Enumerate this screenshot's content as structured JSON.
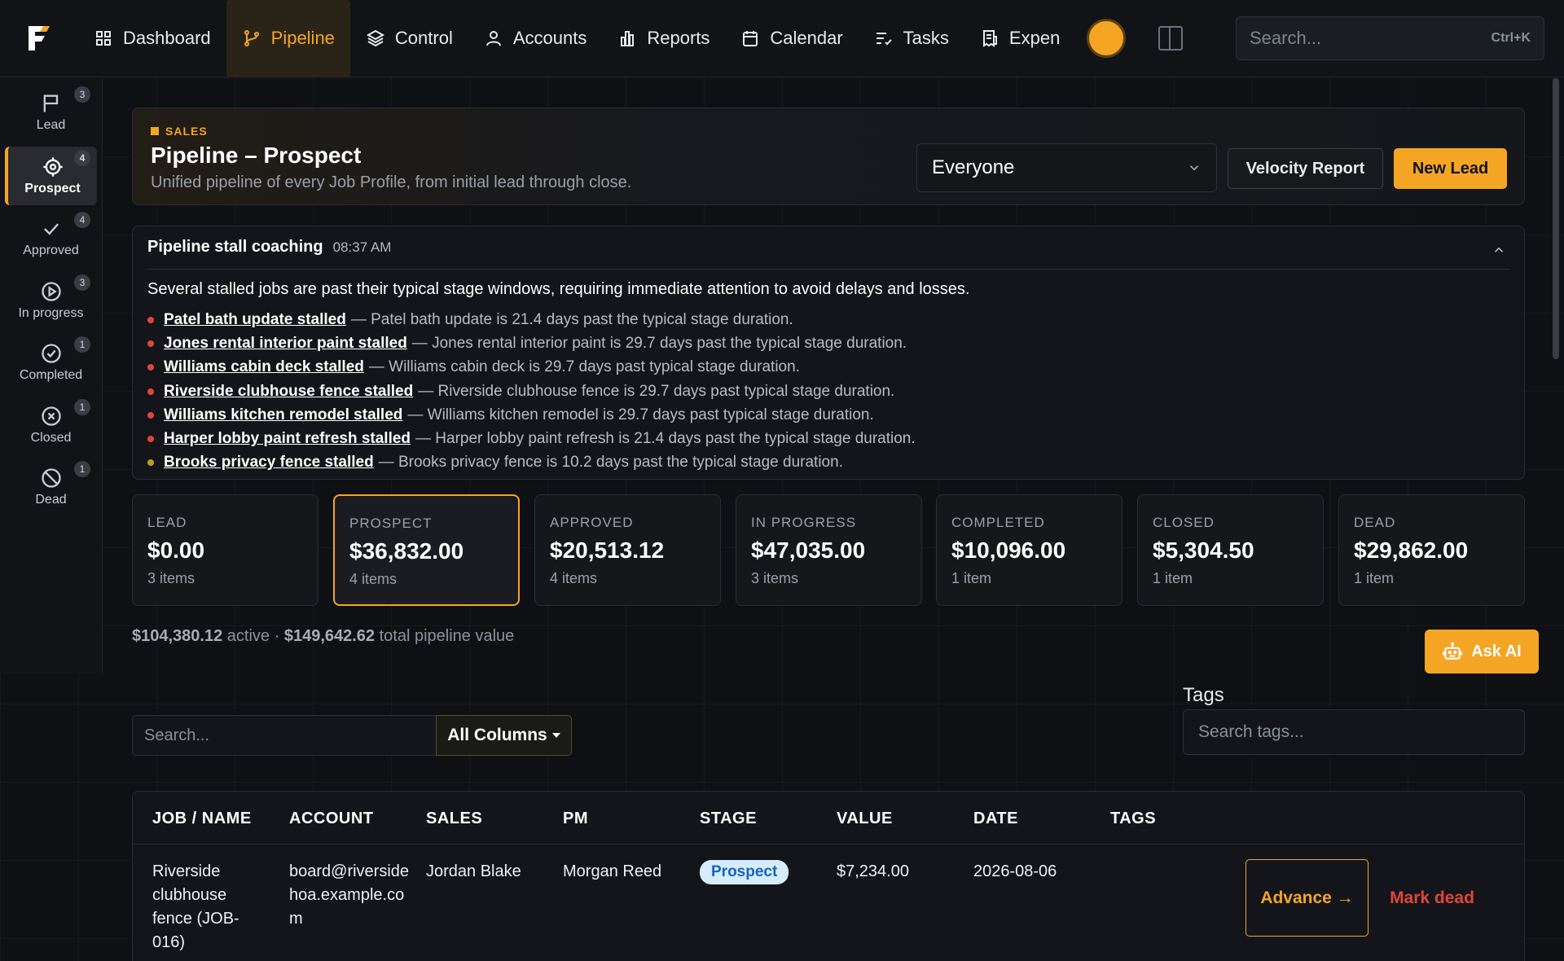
{
  "brand": {
    "logo_letter": "F"
  },
  "nav": {
    "items": [
      {
        "label": "Dashboard",
        "icon": "grid-icon"
      },
      {
        "label": "Pipeline",
        "icon": "branch-icon",
        "active": true
      },
      {
        "label": "Control",
        "icon": "layers-icon"
      },
      {
        "label": "Accounts",
        "icon": "user-icon"
      },
      {
        "label": "Reports",
        "icon": "bar-chart-icon"
      },
      {
        "label": "Calendar",
        "icon": "calendar-icon"
      },
      {
        "label": "Tasks",
        "icon": "list-check-icon"
      },
      {
        "label": "Expen",
        "icon": "receipt-icon"
      }
    ],
    "search_placeholder": "Search...",
    "search_shortcut": "Ctrl+K"
  },
  "sidebar": {
    "items": [
      {
        "label": "Lead",
        "count": "3",
        "icon": "flag-icon"
      },
      {
        "label": "Prospect",
        "count": "4",
        "icon": "target-icon",
        "active": true
      },
      {
        "label": "Approved",
        "count": "4",
        "icon": "check-icon"
      },
      {
        "label": "In progress",
        "count": "3",
        "icon": "play-circle-icon"
      },
      {
        "label": "Completed",
        "count": "1",
        "icon": "check-circle-icon"
      },
      {
        "label": "Closed",
        "count": "1",
        "icon": "x-circle-icon"
      },
      {
        "label": "Dead",
        "count": "1",
        "icon": "ban-icon"
      }
    ]
  },
  "header": {
    "eyebrow": "SALES",
    "title": "Pipeline – Prospect",
    "subtitle": "Unified pipeline of every Job Profile, from initial lead through close.",
    "owner_filter": "Everyone",
    "velocity_button": "Velocity Report",
    "new_lead_button": "New Lead"
  },
  "coaching": {
    "title": "Pipeline stall coaching",
    "time": "08:37 AM",
    "summary": "Several stalled jobs are past their typical stage windows, requiring immediate attention to avoid delays and losses.",
    "items": [
      {
        "link": "Patel bath update stalled",
        "text": "— Patel bath update is 21.4 days past the typical stage duration.",
        "severity_color": "#e0453a"
      },
      {
        "link": "Jones rental interior paint stalled",
        "text": "— Jones rental interior paint is 29.7 days past the typical stage duration.",
        "severity_color": "#e0453a"
      },
      {
        "link": "Williams cabin deck stalled",
        "text": "— Williams cabin deck is 29.7 days past typical stage duration.",
        "severity_color": "#e0453a"
      },
      {
        "link": "Riverside clubhouse fence stalled",
        "text": "— Riverside clubhouse fence is 29.7 days past typical stage duration.",
        "severity_color": "#e0453a"
      },
      {
        "link": "Williams kitchen remodel stalled",
        "text": "— Williams kitchen remodel is 29.7 days past typical stage duration.",
        "severity_color": "#e0453a"
      },
      {
        "link": "Harper lobby paint refresh stalled",
        "text": "— Harper lobby paint refresh is 21.4 days past the typical stage duration.",
        "severity_color": "#e0453a"
      },
      {
        "link": "Brooks privacy fence stalled",
        "text": "— Brooks privacy fence is 10.2 days past the typical stage duration.",
        "severity_color": "#b8a21c"
      }
    ]
  },
  "stages": [
    {
      "name": "LEAD",
      "value": "$0.00",
      "count": "3 items"
    },
    {
      "name": "PROSPECT",
      "value": "$36,832.00",
      "count": "4 items",
      "active": true
    },
    {
      "name": "APPROVED",
      "value": "$20,513.12",
      "count": "4 items"
    },
    {
      "name": "IN PROGRESS",
      "value": "$47,035.00",
      "count": "3 items"
    },
    {
      "name": "COMPLETED",
      "value": "$10,096.00",
      "count": "1 item"
    },
    {
      "name": "CLOSED",
      "value": "$5,304.50",
      "count": "1 item"
    },
    {
      "name": "DEAD",
      "value": "$29,862.00",
      "count": "1 item"
    }
  ],
  "totals": {
    "active_value": "$104,380.12",
    "active_label": "active ·",
    "total_value": "$149,642.62",
    "total_label": "total pipeline value"
  },
  "ask_ai": "Ask AI",
  "filters": {
    "search_placeholder": "Search...",
    "column_select": "All Columns",
    "tags_label": "Tags",
    "tags_placeholder": "Search tags..."
  },
  "table": {
    "columns": [
      "JOB / NAME",
      "ACCOUNT",
      "SALES",
      "PM",
      "STAGE",
      "VALUE",
      "DATE",
      "TAGS"
    ],
    "rows": [
      {
        "job": "Riverside clubhouse fence (JOB-016)",
        "account": "board@riversidehoa.example.com",
        "sales": "Jordan Blake",
        "pm": "Morgan Reed",
        "stage": "Prospect",
        "value": "$7,234.00",
        "date": "2026-08-06",
        "tags": "",
        "advance_label": "Advance →",
        "dead_label": "Mark dead"
      }
    ]
  }
}
